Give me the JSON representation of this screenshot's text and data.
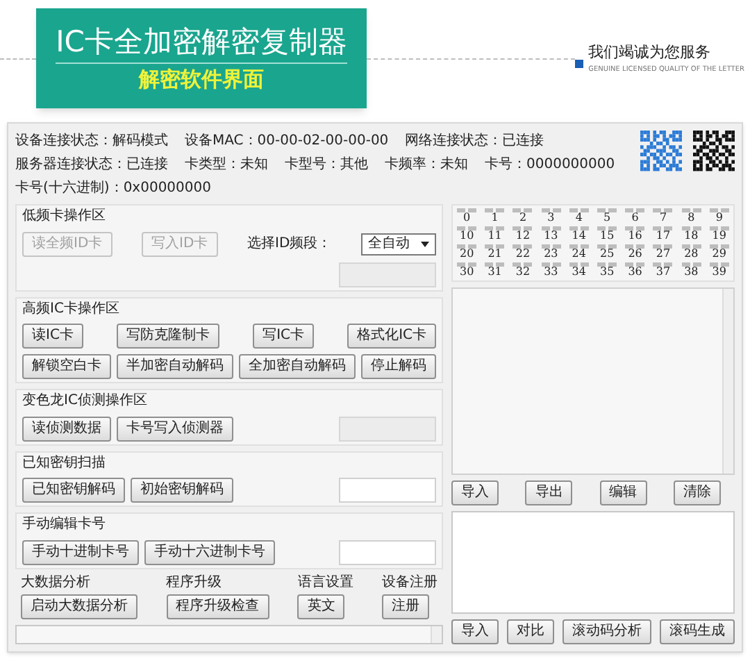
{
  "banner": {
    "title": "IC卡全加密解密复制器",
    "subtitle": "解密软件界面",
    "slogan": "我们竭诚为您服务",
    "slogan_en": "GENUINE LICENSED QUALITY OF THE LETTER"
  },
  "status": [
    {
      "label": "设备连接状态：",
      "value": "解码模式"
    },
    {
      "label": "设备MAC：",
      "value": "00-00-02-00-00-00"
    },
    {
      "label": "网络连接状态：",
      "value": "已连接"
    },
    {
      "label": "服务器连接状态：",
      "value": "已连接"
    },
    {
      "label": "卡类型：",
      "value": "未知"
    },
    {
      "label": "卡型号：",
      "value": "其他"
    },
    {
      "label": "卡频率：",
      "value": "未知"
    },
    {
      "label": "卡号：",
      "value": "0000000000"
    },
    {
      "label": "卡号(十六进制)：",
      "value": "0x00000000"
    }
  ],
  "sections": [
    {
      "title": "低频卡操作区",
      "items": [
        {
          "kind": "button",
          "label": "读全频ID卡",
          "disabled": true
        },
        {
          "kind": "button",
          "label": "写入ID卡",
          "disabled": true
        },
        {
          "kind": "label",
          "label": "选择ID频段："
        },
        {
          "kind": "select",
          "value": "全自动"
        },
        {
          "kind": "field",
          "disabled": true
        }
      ]
    },
    {
      "title": "高频IC卡操作区",
      "items": [
        {
          "kind": "button",
          "label": "读IC卡",
          "disabled": false
        },
        {
          "kind": "button",
          "label": "写防克隆制卡",
          "disabled": false
        },
        {
          "kind": "button",
          "label": "写IC卡",
          "disabled": false
        },
        {
          "kind": "button",
          "label": "格式化IC卡",
          "disabled": false
        },
        {
          "kind": "button",
          "label": "解锁空白卡",
          "disabled": false
        },
        {
          "kind": "button",
          "label": "半加密自动解码",
          "disabled": false
        },
        {
          "kind": "button",
          "label": "全加密自动解码",
          "disabled": false
        },
        {
          "kind": "button",
          "label": "停止解码",
          "disabled": false
        }
      ]
    },
    {
      "title": "变色龙IC侦测操作区",
      "items": [
        {
          "kind": "button",
          "label": "读侦测数据",
          "disabled": false
        },
        {
          "kind": "button",
          "label": "卡号写入侦测器",
          "disabled": false
        },
        {
          "kind": "field",
          "disabled": true
        }
      ]
    },
    {
      "title": "已知密钥扫描",
      "items": [
        {
          "kind": "button",
          "label": "已知密钥解码",
          "disabled": false
        },
        {
          "kind": "button",
          "label": "初始密钥解码",
          "disabled": false
        },
        {
          "kind": "field",
          "disabled": false
        }
      ]
    },
    {
      "title": "手动编辑卡号",
      "items": [
        {
          "kind": "button",
          "label": "手动十进制卡号",
          "disabled": false
        },
        {
          "kind": "button",
          "label": "手动十六进制卡号",
          "disabled": false
        },
        {
          "kind": "field",
          "disabled": false
        }
      ]
    }
  ],
  "tools": [
    {
      "title": "大数据分析",
      "button": "启动大数据分析"
    },
    {
      "title": "程序升级",
      "button": "程序升级检查"
    },
    {
      "title": "语言设置",
      "button": "英文"
    },
    {
      "title": "设备注册",
      "button": "注册"
    }
  ],
  "sectors": [
    "0",
    "1",
    "2",
    "3",
    "4",
    "5",
    "6",
    "7",
    "8",
    "9",
    "10",
    "11",
    "12",
    "13",
    "14",
    "15",
    "16",
    "17",
    "18",
    "19",
    "20",
    "21",
    "22",
    "23",
    "24",
    "25",
    "26",
    "27",
    "28",
    "29",
    "30",
    "31",
    "32",
    "33",
    "34",
    "35",
    "36",
    "37",
    "38",
    "39"
  ],
  "list_buttons": [
    "导入",
    "导出",
    "编辑",
    "清除"
  ],
  "bottom_buttons": [
    "导入",
    "对比",
    "滚动码分析",
    "滚码生成"
  ]
}
